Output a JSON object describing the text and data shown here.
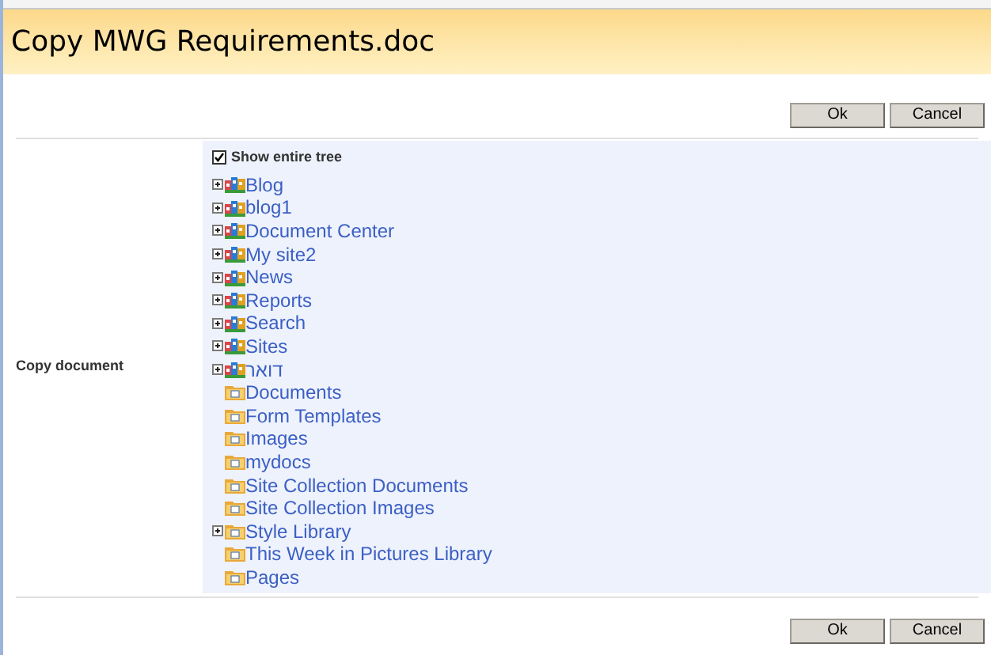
{
  "title": "Copy MWG Requirements.doc",
  "top_buttons": [
    "Ok",
    "Cancel"
  ],
  "field_label": "Copy document",
  "show_entire_tree": {
    "label": "Show entire tree",
    "checked": true
  },
  "tree": [
    {
      "label": "Blog",
      "kind": "site",
      "expandable": true
    },
    {
      "label": "blog1",
      "kind": "site",
      "expandable": true
    },
    {
      "label": "Document Center",
      "kind": "site",
      "expandable": true
    },
    {
      "label": "My site2",
      "kind": "site",
      "expandable": true
    },
    {
      "label": "News",
      "kind": "site",
      "expandable": true
    },
    {
      "label": "Reports",
      "kind": "site",
      "expandable": true
    },
    {
      "label": "Search",
      "kind": "site",
      "expandable": true
    },
    {
      "label": "Sites",
      "kind": "site",
      "expandable": true
    },
    {
      "label": "דואר",
      "kind": "site",
      "expandable": true
    },
    {
      "label": "Documents",
      "kind": "folder",
      "expandable": false
    },
    {
      "label": "Form Templates",
      "kind": "folder",
      "expandable": false
    },
    {
      "label": "Images",
      "kind": "folder",
      "expandable": false
    },
    {
      "label": "mydocs",
      "kind": "folder",
      "expandable": false
    },
    {
      "label": "Site Collection Documents",
      "kind": "folder",
      "expandable": false
    },
    {
      "label": "Site Collection Images",
      "kind": "folder",
      "expandable": false
    },
    {
      "label": "Style Library",
      "kind": "folder",
      "expandable": true
    },
    {
      "label": "This Week in Pictures Library",
      "kind": "folder",
      "expandable": false
    },
    {
      "label": "Pages",
      "kind": "folder",
      "expandable": false
    }
  ],
  "bottom_buttons": [
    "Ok",
    "Cancel"
  ]
}
